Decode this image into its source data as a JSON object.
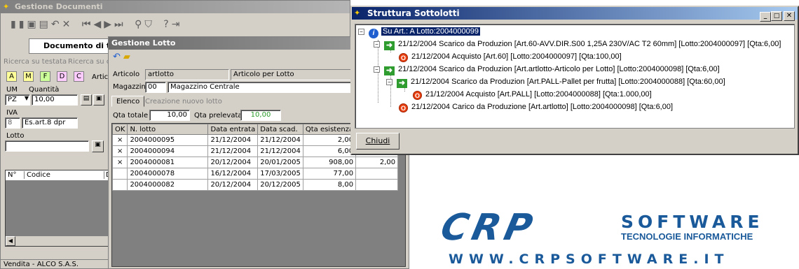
{
  "win_docs": {
    "title": "Gestione Documenti",
    "doc_header": "Documento di trasp",
    "tabs": [
      "Ricerca su testata",
      "Ricerca su co"
    ],
    "color_buttons": [
      {
        "label": "A",
        "color": "#ffff99"
      },
      {
        "label": "M",
        "color": "#ffff99"
      },
      {
        "label": "F",
        "color": "#ccff99"
      },
      {
        "label": "D",
        "color": "#ffccff"
      },
      {
        "label": "C",
        "color": "#ffccff"
      }
    ],
    "artic_label": "Artic",
    "um_label": "UM",
    "um_value": "PZ",
    "quantita_label": "Quantità",
    "quantita_value": "10,00",
    "iva_label": "IVA",
    "iva_code": "8",
    "iva_desc": "Es.art.8 dpr",
    "lotto_label": "Lotto",
    "list_headers": [
      "N°",
      "Codice",
      "D"
    ],
    "status": "Vendita - ALCO S.A.S."
  },
  "win_lotto": {
    "title": "Gestione Lotto",
    "articolo_label": "Articolo",
    "articolo_code": "artlotto",
    "articolo_desc": "Articolo per Lotto",
    "magazzino_label": "Magazzino",
    "magazzino_code": "00",
    "magazzino_desc": "Magazzino Centrale",
    "tabs": [
      "Elenco",
      "Creazione nuovo lotto"
    ],
    "qta_totale_label": "Qta totale",
    "qta_totale_value": "10,00",
    "qta_prelevata_label": "Qta prelevata",
    "qta_prelevata_value": "10,00",
    "columns": [
      "OK",
      "N. lotto",
      "Data entrata",
      "Data scad.",
      "Qta esistenza",
      ""
    ],
    "rows": [
      {
        "ok": "×",
        "lotto": "2004000095",
        "entrata": "21/12/2004",
        "scad": "21/12/2004",
        "qta": "2,00",
        "prel": ""
      },
      {
        "ok": "×",
        "lotto": "2004000094",
        "entrata": "21/12/2004",
        "scad": "21/12/2004",
        "qta": "6,00",
        "prel": ""
      },
      {
        "ok": "×",
        "lotto": "2004000081",
        "entrata": "20/12/2004",
        "scad": "20/01/2005",
        "qta": "908,00",
        "prel": "2,00"
      },
      {
        "ok": "",
        "lotto": "2004000078",
        "entrata": "16/12/2004",
        "scad": "17/03/2005",
        "qta": "77,00",
        "prel": ""
      },
      {
        "ok": "",
        "lotto": "2004000082",
        "entrata": "20/12/2004",
        "scad": "20/12/2005",
        "qta": "8,00",
        "prel": ""
      }
    ]
  },
  "win_struttura": {
    "title": "Struttura Sottolotti",
    "root": "Su Art.: A  Lotto:2004000099",
    "nodes": [
      "21/12/2004 Scarico da Produzion [Art.60-AVV.DIR.S00 1,25A 230V/AC T2 60mm] [Lotto:2004000097] [Qta:6,00]",
      "21/12/2004 Acquisto [Art.60] [Lotto:2004000097] [Qta:100,00]",
      "21/12/2004 Scarico da Produzion [Art.artlotto-Articolo per Lotto] [Lotto:2004000098] [Qta:6,00]",
      "21/12/2004 Scarico da Produzion [Art.PALL-Pallet per frutta] [Lotto:2004000088] [Qta:60,00]",
      "21/12/2004 Acquisto [Art.PALL] [Lotto:2004000088] [Qta:1.000,00]",
      "21/12/2004 Carico da Produzione [Art.artlotto] [Lotto:2004000098] [Qta:6,00]"
    ],
    "close_button": "Chiudi"
  },
  "logo": {
    "brand": "CRP",
    "software": "SOFTWARE",
    "tagline": "TECNOLOGIE INFORMATICHE",
    "url": "WWW.CRPSOFTWARE.IT",
    "color": "#1a5a9a"
  }
}
